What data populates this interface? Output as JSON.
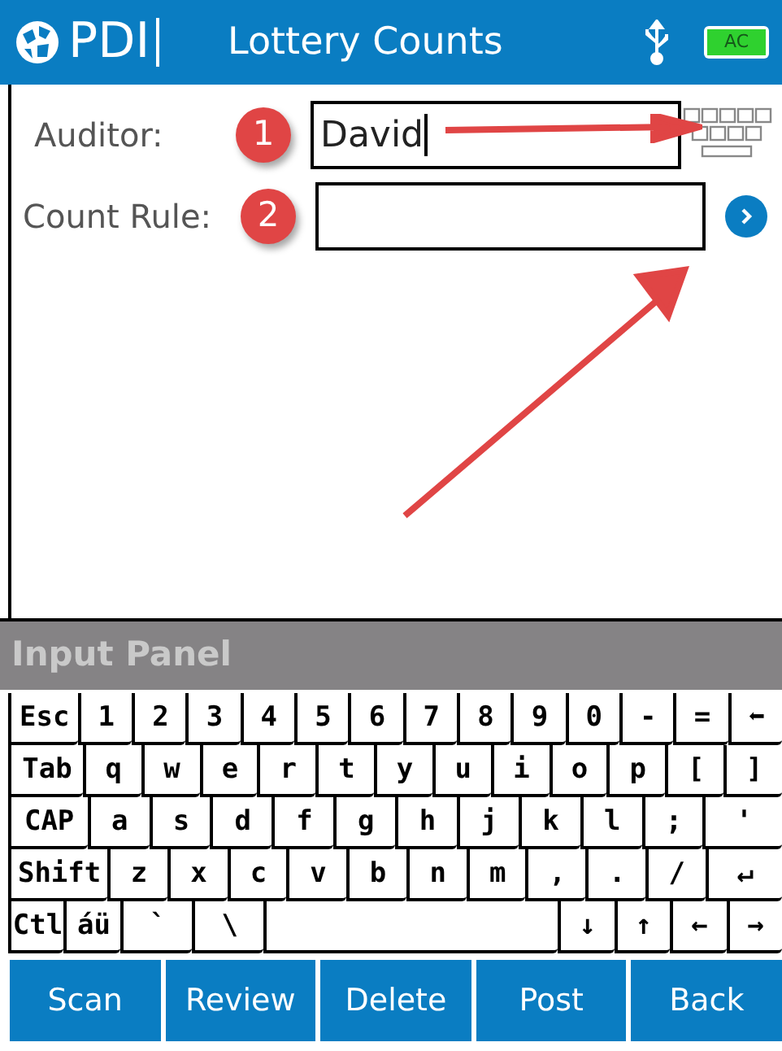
{
  "header": {
    "logo": "PDI",
    "title": "Lottery Counts",
    "battery": "AC"
  },
  "form": {
    "fields": [
      {
        "label": "Auditor:",
        "marker": "1",
        "value": "David",
        "focused": true,
        "kind": "keyboard"
      },
      {
        "label": "Count Rule:",
        "marker": "2",
        "focused": false,
        "kind": "lookup"
      }
    ]
  },
  "input_panel": {
    "title": "Input Panel",
    "rows": [
      {
        "keys": [
          {
            "label": "Esc",
            "kind": "wide"
          },
          {
            "label": "1",
            "kind": "key"
          },
          {
            "label": "2",
            "kind": "key"
          },
          {
            "label": "3",
            "kind": "key"
          },
          {
            "label": "4",
            "kind": "key"
          },
          {
            "label": "5",
            "kind": "key"
          },
          {
            "label": "6",
            "kind": "key"
          },
          {
            "label": "7",
            "kind": "key"
          },
          {
            "label": "8",
            "kind": "key"
          },
          {
            "label": "9",
            "kind": "key"
          },
          {
            "label": "0",
            "kind": "key"
          },
          {
            "label": "-",
            "kind": "key"
          },
          {
            "label": "=",
            "kind": "key"
          },
          {
            "label": "⬅",
            "kind": "key"
          }
        ]
      },
      {
        "keys": [
          {
            "label": "Tab",
            "kind": "wide"
          },
          {
            "label": "q",
            "kind": "key"
          },
          {
            "label": "w",
            "kind": "key"
          },
          {
            "label": "e",
            "kind": "key"
          },
          {
            "label": "r",
            "kind": "key"
          },
          {
            "label": "t",
            "kind": "key"
          },
          {
            "label": "y",
            "kind": "key"
          },
          {
            "label": "u",
            "kind": "key"
          },
          {
            "label": "i",
            "kind": "key"
          },
          {
            "label": "o",
            "kind": "key"
          },
          {
            "label": "p",
            "kind": "key"
          },
          {
            "label": "[",
            "kind": "key"
          },
          {
            "label": "]",
            "kind": "key"
          }
        ]
      },
      {
        "keys": [
          {
            "label": "CAP",
            "kind": "wide"
          },
          {
            "label": "a",
            "kind": "key"
          },
          {
            "label": "s",
            "kind": "key"
          },
          {
            "label": "d",
            "kind": "key"
          },
          {
            "label": "f",
            "kind": "key"
          },
          {
            "label": "g",
            "kind": "key"
          },
          {
            "label": "h",
            "kind": "key"
          },
          {
            "label": "j",
            "kind": "key"
          },
          {
            "label": "k",
            "kind": "key"
          },
          {
            "label": "l",
            "kind": "key"
          },
          {
            "label": ";",
            "kind": "key"
          },
          {
            "label": "'",
            "kind": "wide"
          }
        ]
      },
      {
        "keys": [
          {
            "label": "Shift",
            "kind": "extra"
          },
          {
            "label": "z",
            "kind": "key"
          },
          {
            "label": "x",
            "kind": "key"
          },
          {
            "label": "c",
            "kind": "key"
          },
          {
            "label": "v",
            "kind": "key"
          },
          {
            "label": "b",
            "kind": "key"
          },
          {
            "label": "n",
            "kind": "key"
          },
          {
            "label": "m",
            "kind": "key"
          },
          {
            "label": ",",
            "kind": "key"
          },
          {
            "label": ".",
            "kind": "key"
          },
          {
            "label": "/",
            "kind": "key"
          },
          {
            "label": "↵",
            "kind": "wide"
          }
        ]
      },
      {
        "keys": [
          {
            "label": "Ctl",
            "kind": "key"
          },
          {
            "label": "áü",
            "kind": "key"
          },
          {
            "label": "`",
            "kind": "wide"
          },
          {
            "label": "\\",
            "kind": "wide"
          },
          {
            "kind": "space"
          },
          {
            "label": "↓",
            "kind": "key"
          },
          {
            "label": "↑",
            "kind": "key"
          },
          {
            "label": "←",
            "kind": "key"
          },
          {
            "label": "→",
            "kind": "key"
          }
        ]
      }
    ]
  },
  "toolbar": {
    "buttons": [
      "Scan",
      "Review",
      "Delete",
      "Post",
      "Back"
    ]
  }
}
